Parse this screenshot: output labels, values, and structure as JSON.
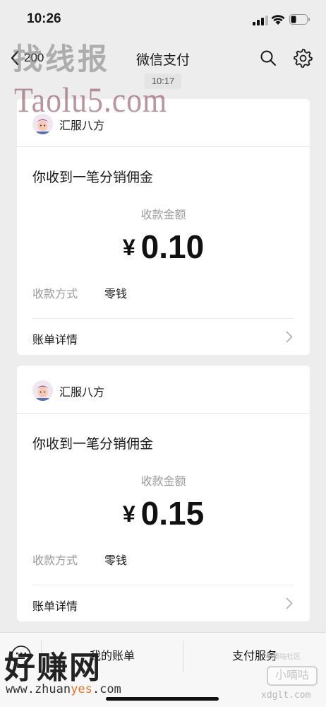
{
  "status_bar": {
    "time": "10:26"
  },
  "nav": {
    "back_count": "200",
    "title": "微信支付"
  },
  "timestamp": "10:17",
  "cards": [
    {
      "merchant": "汇服八方",
      "title": "你收到一笔分销佣金",
      "amount_label": "收款金额",
      "currency": "¥",
      "amount": "0.10",
      "method_label": "收款方式",
      "method_value": "零钱",
      "detail_label": "账单详情"
    },
    {
      "merchant": "汇服八方",
      "title": "你收到一笔分销佣金",
      "amount_label": "收款金额",
      "currency": "¥",
      "amount": "0.15",
      "method_label": "收款方式",
      "method_value": "零钱",
      "detail_label": "账单详情"
    }
  ],
  "bottom_bar": {
    "menu_bill": "我的账单",
    "menu_service": "支付服务"
  },
  "watermarks": {
    "top_text": "找线报",
    "site": "Taolu5.com",
    "bottom_text": "好赚网",
    "bottom_url_prefix": "www.zhuan",
    "bottom_url_accent": "yes",
    "bottom_url_suffix": ".com",
    "side_small": "小嘀咕社区",
    "side_badge": "小嘀咕",
    "side_url": "xdglt.com"
  },
  "colors": {
    "background": "#ededed",
    "card": "#ffffff",
    "secondary_text": "#9a9a9a",
    "url_accent": "#e0762b"
  },
  "icons": {
    "status": [
      "signal-icon",
      "wifi-icon",
      "battery-icon"
    ],
    "nav": [
      "back-chevron-icon",
      "search-icon",
      "gear-icon"
    ],
    "bottom": [
      "keyboard-icon"
    ],
    "card": [
      "avatar",
      "chevron-right-icon"
    ]
  }
}
